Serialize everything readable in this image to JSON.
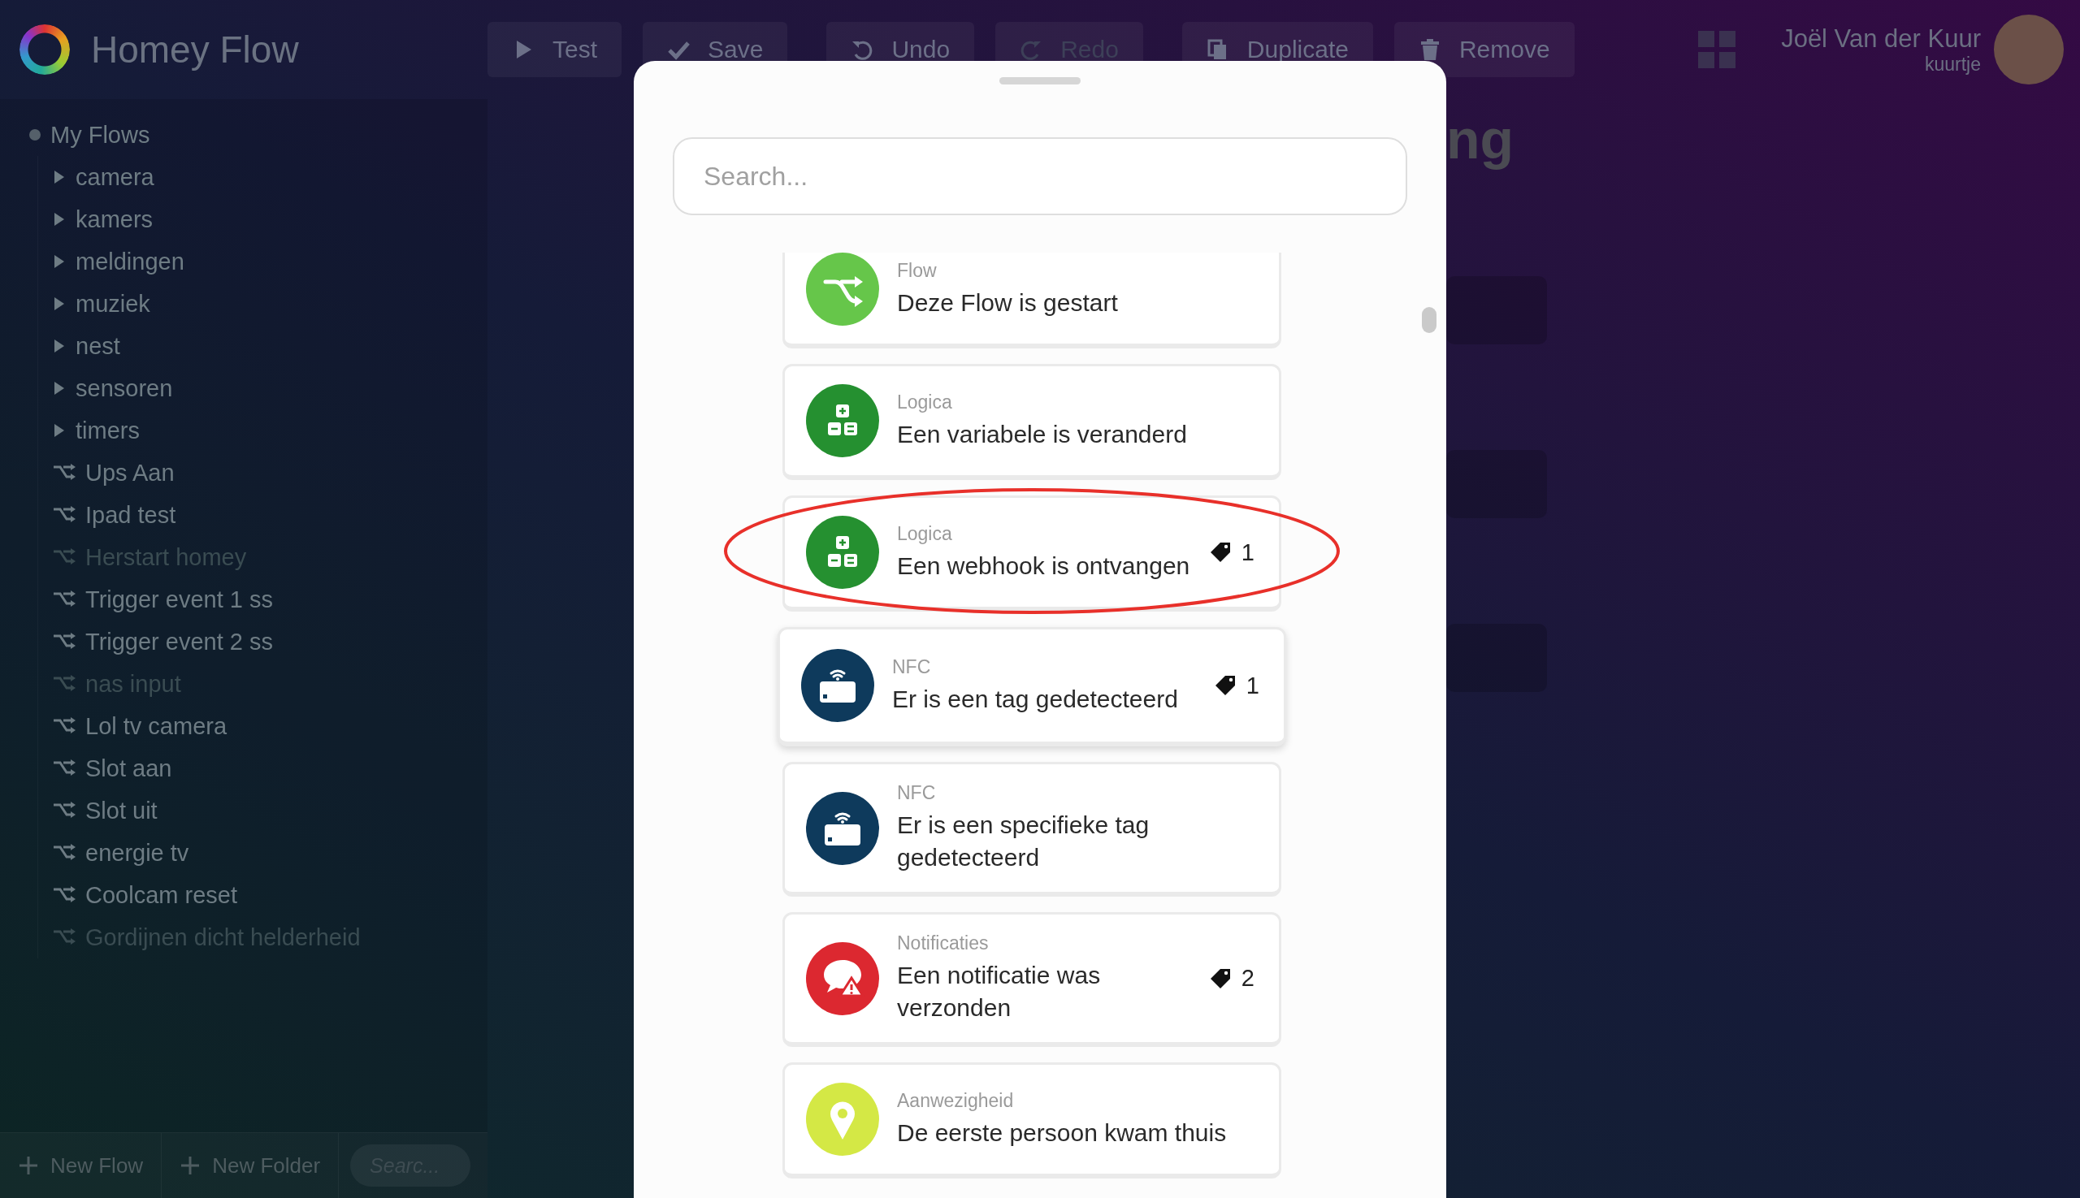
{
  "app": {
    "title": "Homey Flow"
  },
  "toolbar_groups": [
    {
      "buttons": [
        {
          "label": "Test",
          "kind": "play",
          "disabled": false
        },
        {
          "label": "Save",
          "kind": "check",
          "disabled": false
        }
      ]
    },
    {
      "buttons": [
        {
          "label": "Undo",
          "kind": "undo",
          "disabled": false
        },
        {
          "label": "Redo",
          "kind": "redo",
          "disabled": true
        }
      ]
    },
    {
      "buttons": [
        {
          "label": "Duplicate",
          "kind": "copy",
          "disabled": false
        },
        {
          "label": "Remove",
          "kind": "trash",
          "disabled": false
        }
      ]
    }
  ],
  "user": {
    "name": "Joël Van der Kuur",
    "username": "kuurtje"
  },
  "sidebar": {
    "tree": {
      "label": "My Flows",
      "children": [
        {
          "kind": "folder",
          "label": "camera",
          "expanded": false
        },
        {
          "kind": "folder",
          "label": "kamers",
          "expanded": false
        },
        {
          "kind": "folder",
          "label": "meldingen",
          "expanded": false
        },
        {
          "kind": "folder",
          "label": "muziek",
          "expanded": false
        },
        {
          "kind": "folder",
          "label": "nest",
          "expanded": false
        },
        {
          "kind": "folder",
          "label": "sensoren",
          "expanded": false
        },
        {
          "kind": "folder",
          "label": "timers",
          "expanded": false
        },
        {
          "kind": "flow",
          "label": "Ups Aan",
          "disabled": false
        },
        {
          "kind": "flow",
          "label": "Ipad test",
          "disabled": false
        },
        {
          "kind": "flow",
          "label": "Herstart homey",
          "disabled": true
        },
        {
          "kind": "flow",
          "label": "Trigger event 1 ss",
          "disabled": false
        },
        {
          "kind": "flow",
          "label": "Trigger event 2 ss",
          "disabled": false
        },
        {
          "kind": "flow",
          "label": "nas input",
          "disabled": true
        },
        {
          "kind": "flow",
          "label": "Lol tv camera",
          "disabled": false
        },
        {
          "kind": "flow",
          "label": "Slot aan",
          "disabled": false
        },
        {
          "kind": "flow",
          "label": "Slot uit",
          "disabled": false
        },
        {
          "kind": "flow",
          "label": "energie tv",
          "disabled": false
        },
        {
          "kind": "flow",
          "label": "Coolcam reset",
          "disabled": false
        },
        {
          "kind": "flow",
          "label": "Gordijnen dicht helderheid",
          "disabled": true
        }
      ]
    },
    "footer": {
      "new_flow": "New Flow",
      "new_folder": "New Folder",
      "search_placeholder": "Searc..."
    }
  },
  "main": {
    "heading": "ng"
  },
  "card_picker": {
    "search_placeholder": "Search...",
    "cards": [
      {
        "category": "Flow",
        "title": "Deze Flow is gestart",
        "kind": "flow",
        "color": "#66c64a",
        "hovered": false,
        "circled": false
      },
      {
        "category": "Logica",
        "title": "Een variabele is veranderd",
        "kind": "logic",
        "color": "#259030",
        "hovered": false,
        "circled": false
      },
      {
        "category": "Logica",
        "title": "Een webhook is ontvangen",
        "kind": "logic",
        "color": "#259030",
        "tag_count": "1",
        "hovered": false,
        "circled": true
      },
      {
        "category": "NFC",
        "title": "Er is een tag gedetecteerd",
        "kind": "nfc",
        "color": "#0e3a5c",
        "tag_count": "1",
        "hovered": true,
        "circled": false
      },
      {
        "category": "NFC",
        "title": "Er is een specifieke tag gedetecteerd",
        "kind": "nfc",
        "color": "#0e3a5c",
        "hovered": false,
        "circled": false
      },
      {
        "category": "Notificaties",
        "title": "Een notificatie was verzonden",
        "kind": "notification",
        "color": "#dc2830",
        "tag_count": "2",
        "hovered": false,
        "circled": false
      },
      {
        "category": "Aanwezigheid",
        "title": "De eerste persoon kwam thuis",
        "kind": "presence",
        "color": "#d4e845",
        "hovered": false,
        "circled": false
      }
    ]
  }
}
